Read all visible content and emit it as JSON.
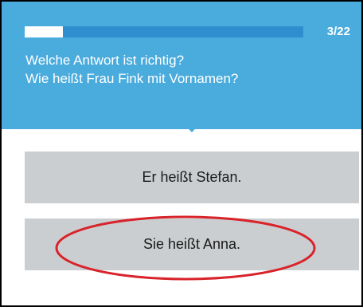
{
  "progress": {
    "label": "3/22",
    "fraction": 0.136
  },
  "question": {
    "instruction": "Welche Antwort ist richtig?",
    "text": "Wie heißt Frau Fink mit Vornamen?"
  },
  "answers": [
    {
      "label": "Er heißt Stefan."
    },
    {
      "label": "Sie heißt Anna."
    }
  ],
  "highlight": {
    "answer_index": 1,
    "color": "#d9232b"
  },
  "colors": {
    "accent": "#4aabdd",
    "progress_track": "#2e8fd0",
    "answer_bg": "#cbced0"
  }
}
